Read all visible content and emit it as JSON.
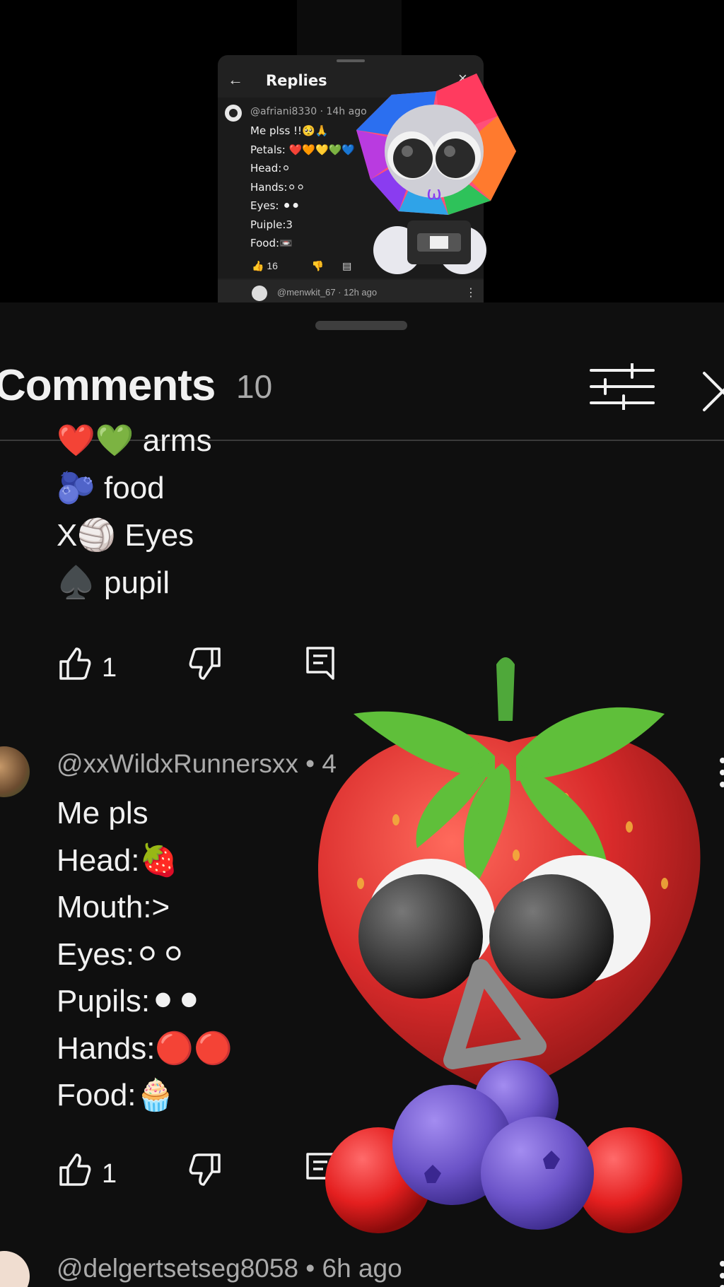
{
  "replies_panel": {
    "back_label": "←",
    "title": "Replies",
    "close_label": "×",
    "comment": {
      "handle": "@afriani8330 · 14h ago",
      "lines": [
        "Me plss !!🥺🙏",
        "Petals: ❤️🧡💛💚💙",
        "Head:⚪",
        "Hands:⚪⚪",
        "Eyes: ⚫⚫",
        "Puiple:3",
        "Food:📼"
      ],
      "likes": "16"
    },
    "next_handle": "@menwkit_67 · 12h ago"
  },
  "sheet": {
    "title": "Comments",
    "count": "10"
  },
  "previous_comment": {
    "lines": [
      "❤️💚 arms",
      "🫐 food",
      "X🏐 Eyes",
      "♠️ pupil"
    ],
    "likes": "1"
  },
  "comment_wildrunners": {
    "handle": "@xxWildxRunnersxx • 4",
    "lines": [
      "Me pls",
      "Head:🍓",
      "Mouth:>",
      "Eyes:⚪⚪",
      "Pupils:⚫⚫",
      "Hands:🔴🔴",
      "Food:🧁"
    ],
    "likes": "1"
  },
  "comment_delgertsetseg": {
    "handle": "@delgertsetseg8058 • 6h ago"
  },
  "icons": {
    "like": "thumbs-up-icon",
    "dislike": "thumbs-down-icon",
    "reply": "reply-icon",
    "filter": "filter-icon",
    "close": "close-icon",
    "more": "more-vert-icon"
  },
  "colors": {
    "sheet_bg": "#0f0f0f",
    "text": "#f1f1f1",
    "secondary_text": "#aaaaaa",
    "strawberry": "#d92b2b",
    "blueberry": "#6a52c7"
  }
}
